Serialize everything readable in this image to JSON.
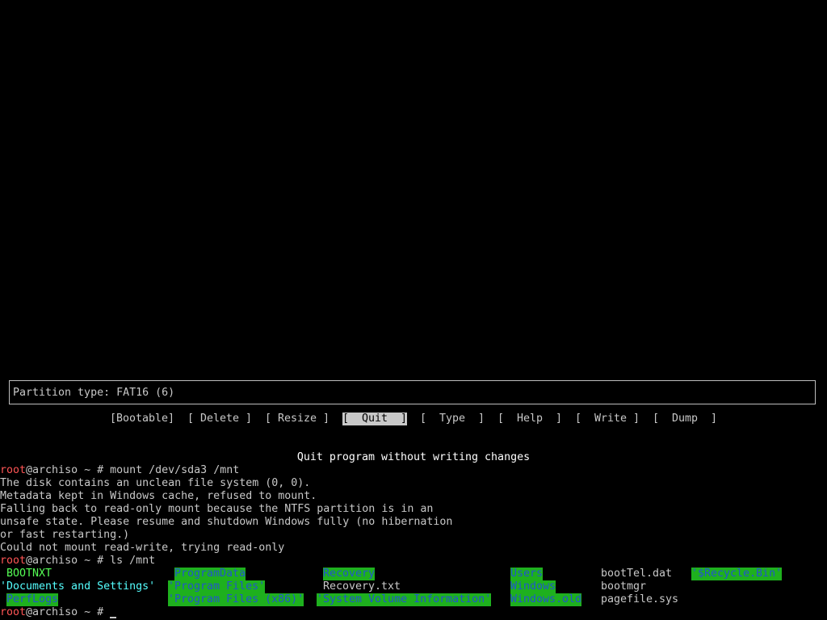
{
  "info_box": {
    "text": "Partition type: FAT16 (6)"
  },
  "menu": {
    "items": [
      {
        "label": "[Bootable]"
      },
      {
        "label": "[ Delete ]"
      },
      {
        "label": "[ Resize ]"
      },
      {
        "label": "[  Quit  ]"
      },
      {
        "label": "[  Type  ]"
      },
      {
        "label": "[  Help  ]"
      },
      {
        "label": "[  Write ]"
      },
      {
        "label": "[  Dump  ]"
      }
    ],
    "selected": "[  Quit  ]",
    "description": "Quit program without writing changes"
  },
  "terminal": {
    "prompt_user": "root",
    "prompt_host": "@archiso ~ # ",
    "cmd1": "mount /dev/sda3 /mnt",
    "out1": "The disk contains an unclean file system (0, 0).",
    "out2": "Metadata kept in Windows cache, refused to mount.",
    "out3": "Falling back to read-only mount because the NTFS partition is in an",
    "out4": "unsafe state. Please resume and shutdown Windows fully (no hibernation",
    "out5": "or fast restarting.)",
    "out6": "Could not mount read-write, trying read-only",
    "cmd2": "ls /mnt",
    "ls": {
      "bootnxt": "BOOTNXT",
      "programdata": "ProgramData",
      "recovery": "Recovery",
      "users": "Users",
      "boottel": "bootTel.dat",
      "recyclebin": "'$Recycle.Bin'",
      "docs_settings": "'Documents and Settings'",
      "program_files": "'Program Files'",
      "recovery_txt": "Recovery.txt",
      "windows": "Windows",
      "bootmgr": "bootmgr",
      "perflogs": "PerfLogs",
      "program_files_x86": "'Program Files (x86)'",
      "system_volume": "'System Volume Information'",
      "windows_old": "Windows.old",
      "pagefile": "pagefile.sys"
    }
  }
}
